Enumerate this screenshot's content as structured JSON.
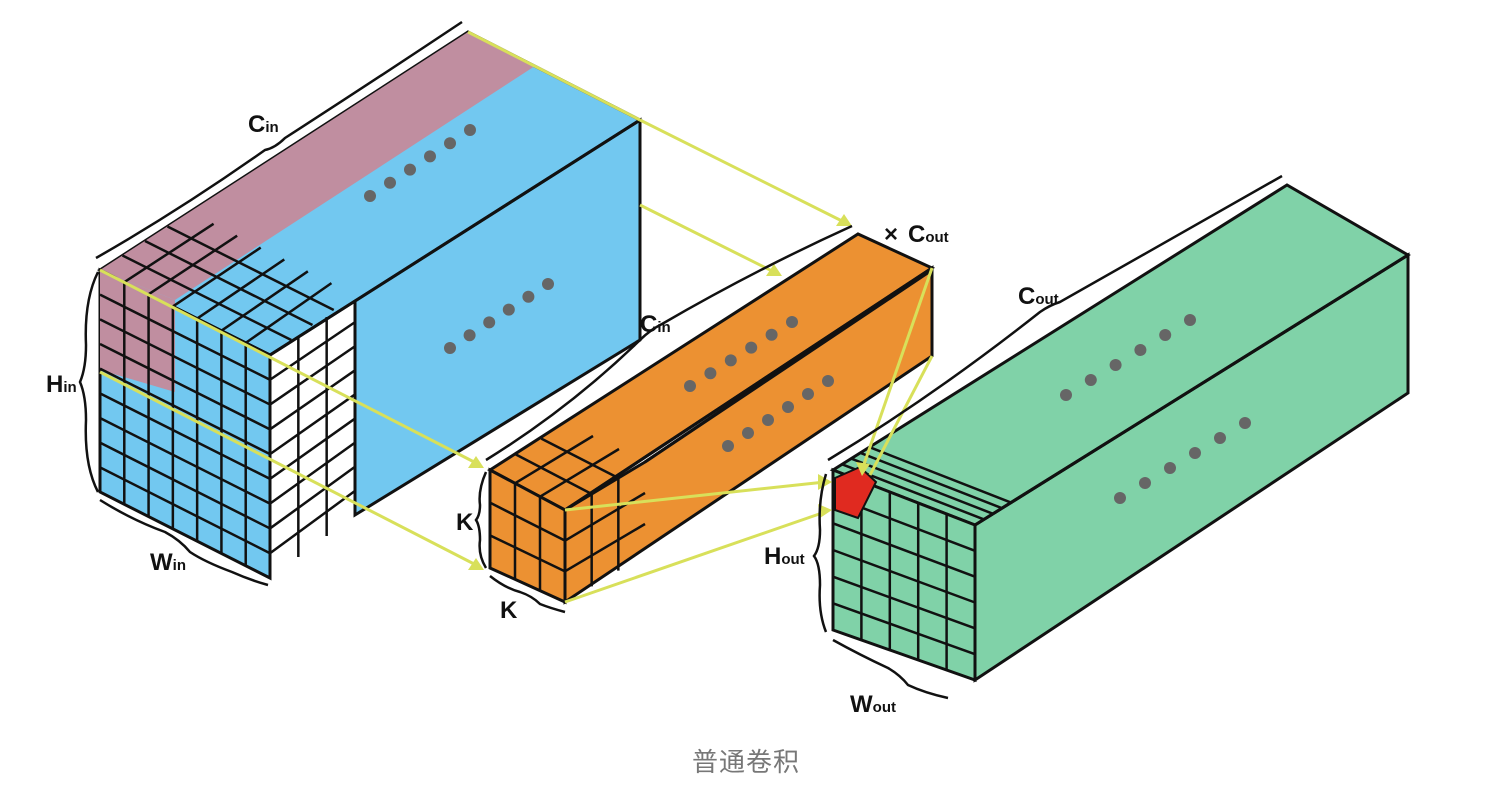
{
  "colors": {
    "input": "#72c8f0",
    "input_highlight": "#c08ea0",
    "kernel": "#ec9132",
    "output": "#80d2a8",
    "output_pixel": "#e02a20",
    "connector": "#d8e05a",
    "outline": "#111111",
    "dots": "#666666"
  },
  "labels": {
    "c_in_top": {
      "main": "C",
      "sub": "in"
    },
    "h_in": {
      "main": "H",
      "sub": "in"
    },
    "w_in": {
      "main": "W",
      "sub": "in"
    },
    "c_in_kernel": {
      "main": "C",
      "sub": "in"
    },
    "times": "×",
    "c_out_kernel": {
      "main": "C",
      "sub": "out"
    },
    "k_vertical": "K",
    "k_horizontal": "K",
    "c_out": {
      "main": "C",
      "sub": "out"
    },
    "h_out": {
      "main": "H",
      "sub": "out"
    },
    "w_out": {
      "main": "W",
      "sub": "out"
    }
  },
  "caption": "普通卷积"
}
